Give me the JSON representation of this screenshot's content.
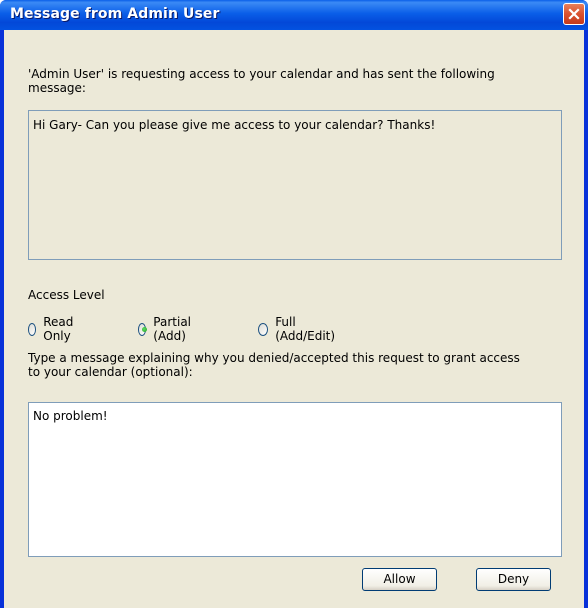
{
  "window": {
    "title": "Message from Admin User"
  },
  "request": {
    "intro_line1": "'Admin User' is requesting access to your calendar and has sent the following",
    "intro_line2": "message:",
    "message": "Hi Gary- Can you please give me access to your calendar? Thanks!"
  },
  "access": {
    "label": "Access Level",
    "options": [
      {
        "label": "Read Only",
        "selected": false
      },
      {
        "label": "Partial (Add)",
        "selected": true
      },
      {
        "label": "Full (Add/Edit)",
        "selected": false
      }
    ]
  },
  "reply": {
    "prompt_line1": "Type a message explaining why you denied/accepted this request to grant access",
    "prompt_line2": "to your calendar (optional):",
    "value": "No problem!"
  },
  "buttons": {
    "allow": "Allow",
    "deny": "Deny"
  },
  "colors": {
    "titlebar": "#0a5ee8",
    "dialog_bg": "#ece9d8",
    "field_border": "#7f9db9",
    "close_button": "#d9512f"
  }
}
